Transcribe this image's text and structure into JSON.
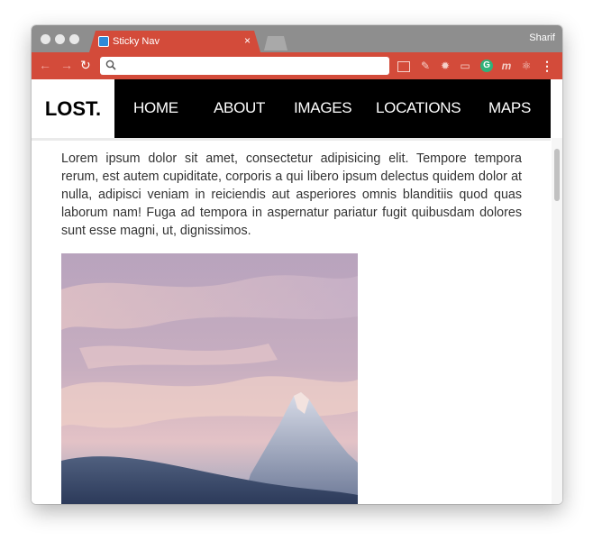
{
  "browser": {
    "tab_title": "Sticky Nav",
    "tab_close": "×",
    "profile_name": "Sharif",
    "back_icon": "←",
    "forward_icon": "→",
    "reload_icon": "↻",
    "menu_icon": "⋮",
    "address_value": "",
    "accent_color": "#d34b3a"
  },
  "site": {
    "logo": "LOST.",
    "nav": [
      "HOME",
      "ABOUT",
      "IMAGES",
      "LOCATIONS",
      "MAPS"
    ],
    "body_text": "Lorem ipsum dolor sit amet, consectetur adipisicing elit. Tempore tempora rerum, est autem cupiditate, corporis a qui libero ipsum delectus quidem dolor at nulla, adipisci veniam in reiciendis aut asperiores omnis blanditiis quod quas laborum nam! Fuga ad tempora in aspernatur pariatur fugit quibusdam dolores sunt esse magni, ut, dignissimos.",
    "image_subject": "mountain-peak-at-sunset"
  }
}
